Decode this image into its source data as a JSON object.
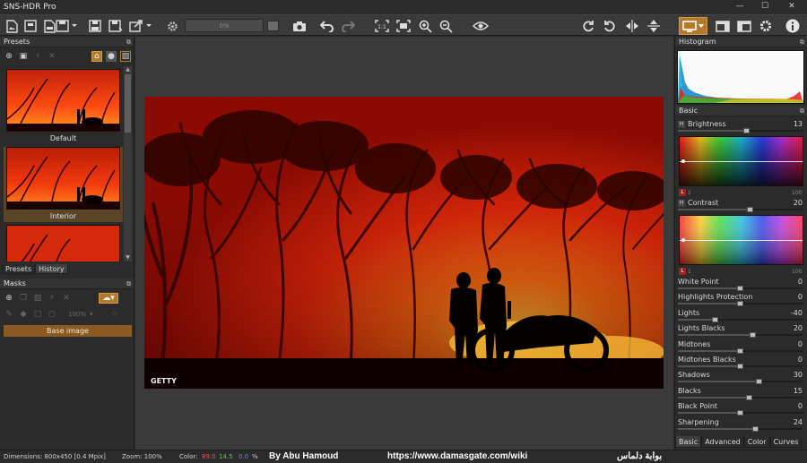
{
  "window": {
    "title": "SNS-HDR Pro",
    "minimize": "—",
    "maximize": "☐",
    "close": "✕"
  },
  "toolbar": {
    "progress_text": "0%",
    "icons": [
      "new-file-icon",
      "open-icon",
      "sns-file-icon",
      "save-icon",
      "save-as-icon",
      "export-icon",
      "settings-gear-icon",
      "camera-icon",
      "undo-icon",
      "redo-icon",
      "actual-size-icon",
      "fit-icon",
      "zoom-in-icon",
      "zoom-out-icon",
      "eye-icon",
      "rotate-cw-icon",
      "rotate-ccw-icon",
      "flip-horizontal-icon",
      "flip-vertical-icon",
      "monitor-icon",
      "layout-1-icon",
      "layout-2-icon",
      "preferences-gear-icon",
      "info-icon"
    ]
  },
  "presets_panel": {
    "header": "Presets",
    "items": [
      {
        "label": "Default",
        "selected": false
      },
      {
        "label": "Interior",
        "selected": true
      },
      {
        "label": "",
        "selected": false
      }
    ],
    "tabs": [
      "Presets",
      "History"
    ],
    "active_tab": "History"
  },
  "masks_panel": {
    "header": "Masks",
    "opacity": "100%",
    "base_label": "Base image"
  },
  "photo": {
    "watermark": "GETTY"
  },
  "histogram": {
    "header": "Histogram"
  },
  "basic": {
    "header": "Basic",
    "brightness": {
      "label": "Brightness",
      "value": "13",
      "badge": "H",
      "fraction": 0.55
    },
    "contrast": {
      "label": "Contrast",
      "value": "20",
      "badge": "H",
      "fraction": 0.58
    },
    "grad_l_badge": "L",
    "scale_min": "1",
    "scale_max": "100",
    "sliders": [
      {
        "label": "White Point",
        "value": "0",
        "fraction": 0.5
      },
      {
        "label": "Highlights Protection",
        "value": "0",
        "fraction": 0.5
      },
      {
        "label": "Lights",
        "value": "-40",
        "fraction": 0.3
      },
      {
        "label": "Lights Blacks",
        "value": "20",
        "fraction": 0.6
      },
      {
        "label": "Midtones",
        "value": "0",
        "fraction": 0.5
      },
      {
        "label": "Midtones Blacks",
        "value": "0",
        "fraction": 0.5
      },
      {
        "label": "Shadows",
        "value": "30",
        "fraction": 0.65
      },
      {
        "label": "Blacks",
        "value": "15",
        "fraction": 0.57
      },
      {
        "label": "Black Point",
        "value": "0",
        "fraction": 0.5
      },
      {
        "label": "Sharpening",
        "value": "24",
        "fraction": 0.62
      }
    ],
    "tabs": [
      "Basic",
      "Advanced",
      "Color",
      "Curves"
    ],
    "active_tab": "Basic"
  },
  "status": {
    "dimensions": "Dimensions: 800x450 [0.4 Mpix]",
    "zoom": "Zoom: 100%",
    "color_label": "Color:",
    "color_r": "89.0",
    "color_g": "14.5",
    "color_b": "0.0",
    "color_unit": "%",
    "credit": "By Abu Hamoud",
    "url": "https://www.damasgate.com/wiki",
    "arabic": "بوابة دلماس"
  },
  "colors": {
    "accent": "#b27a2a",
    "red": "#e05050",
    "green": "#60c060",
    "blue": "#5a8ae0"
  }
}
